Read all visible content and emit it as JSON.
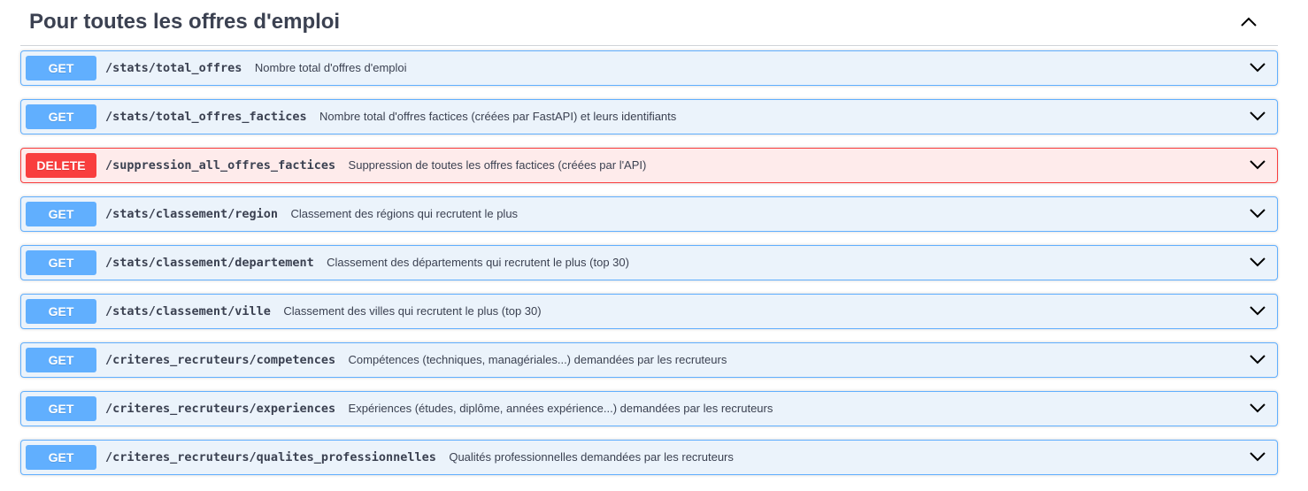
{
  "section": {
    "title": "Pour toutes les offres d'emploi",
    "toggle_icon": "chevron-up-icon"
  },
  "colors": {
    "get": "#61affe",
    "get_bg": "#ebf3fb",
    "delete": "#f93e3e",
    "delete_bg": "#feebeb",
    "text": "#3b4151"
  },
  "operations": [
    {
      "method": "GET",
      "path": "/stats/total_offres",
      "summary": "Nombre total d'offres d'emploi"
    },
    {
      "method": "GET",
      "path": "/stats/total_offres_factices",
      "summary": "Nombre total d'offres factices (créées par FastAPI) et leurs identifiants"
    },
    {
      "method": "DELETE",
      "path": "/suppression_all_offres_factices",
      "summary": "Suppression de toutes les offres factices (créées par l'API)"
    },
    {
      "method": "GET",
      "path": "/stats/classement/region",
      "summary": "Classement des régions qui recrutent le plus"
    },
    {
      "method": "GET",
      "path": "/stats/classement/departement",
      "summary": "Classement des départements qui recrutent le plus (top 30)"
    },
    {
      "method": "GET",
      "path": "/stats/classement/ville",
      "summary": "Classement des villes qui recrutent le plus (top 30)"
    },
    {
      "method": "GET",
      "path": "/criteres_recruteurs/competences",
      "summary": "Compétences (techniques, managériales...) demandées par les recruteurs"
    },
    {
      "method": "GET",
      "path": "/criteres_recruteurs/experiences",
      "summary": "Expériences (études, diplôme, années expérience...) demandées par les recruteurs"
    },
    {
      "method": "GET",
      "path": "/criteres_recruteurs/qualites_professionnelles",
      "summary": "Qualités professionnelles demandées par les recruteurs"
    }
  ]
}
